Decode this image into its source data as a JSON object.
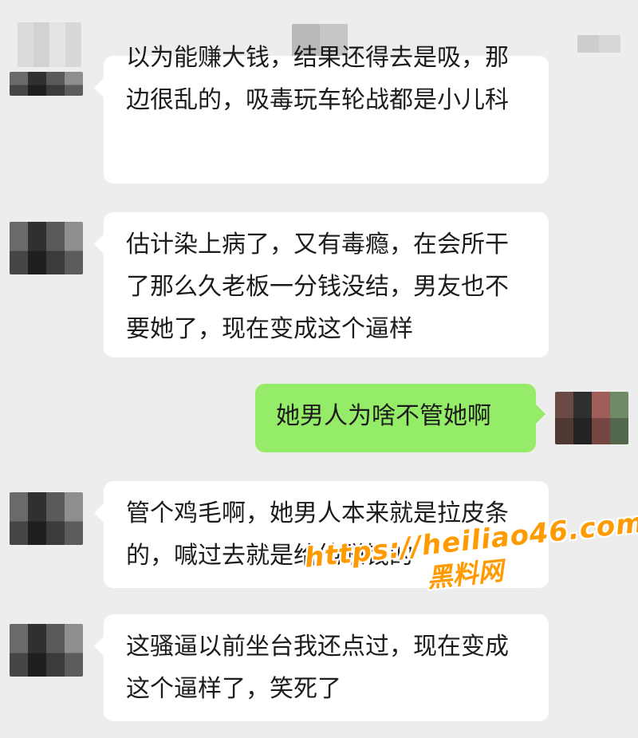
{
  "messages": [
    {
      "side": "in",
      "text": "以为能赚大钱，结果还得去是吸，那边很乱的，吸毒玩车轮战都是小儿科"
    },
    {
      "side": "in",
      "text": "估计染上病了，又有毒瘾，在会所干了那么久老板一分钱没结，男友也不要她了，现在变成这个逼样"
    },
    {
      "side": "out",
      "text": "她男人为啥不管她啊"
    },
    {
      "side": "in",
      "text": "管个鸡毛啊，她男人本来就是拉皮条的，喊过去就是给他赚钱的"
    },
    {
      "side": "in",
      "text": "这骚逼以前坐台我还点过，现在变成这个逼样了，笑死了"
    }
  ],
  "watermark": {
    "url": "https://heiliao46.com",
    "name": "黑料网"
  },
  "colors": {
    "background": "#ededed",
    "incoming_bubble": "#ffffff",
    "outgoing_bubble": "#95ec69",
    "watermark": "#ff9a00"
  }
}
